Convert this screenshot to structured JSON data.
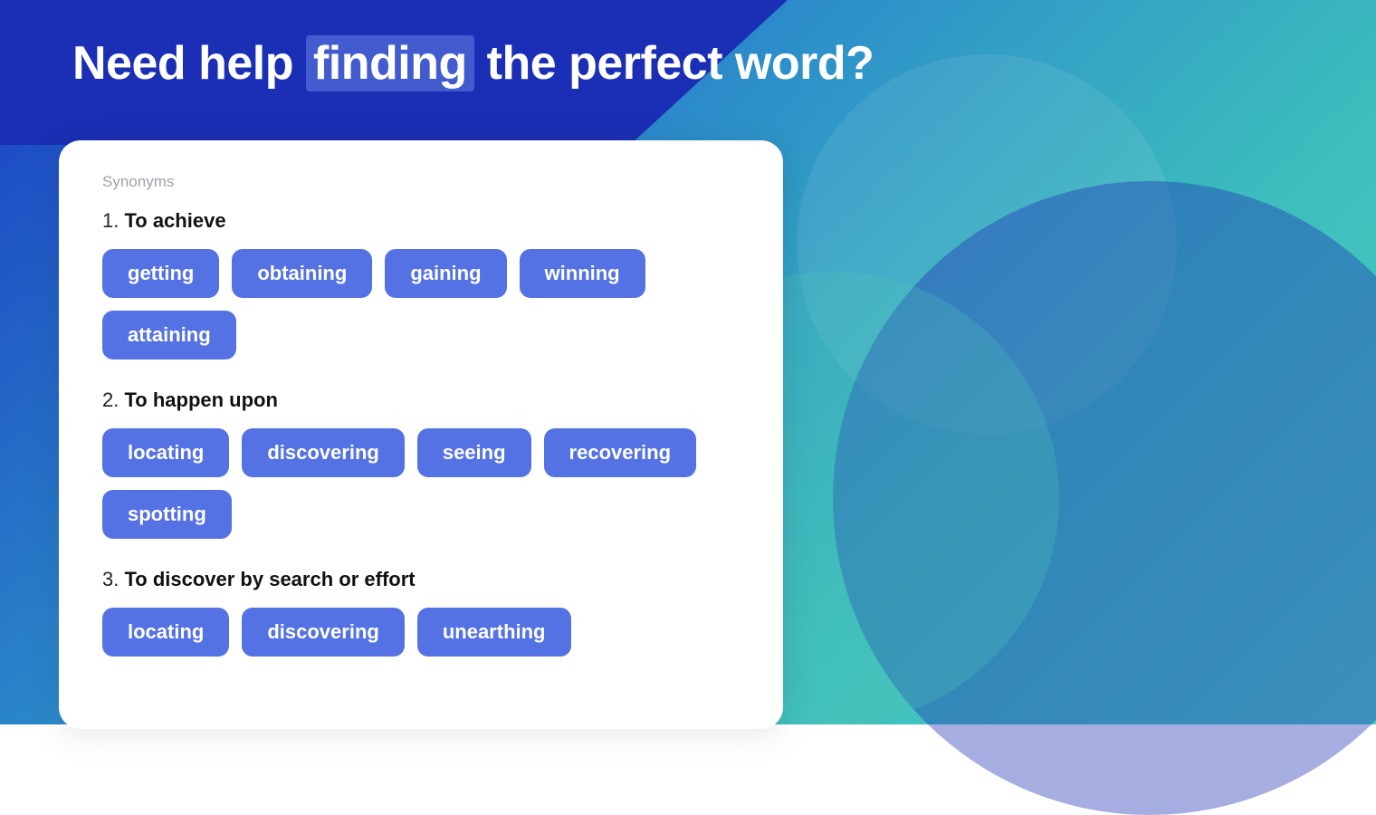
{
  "header": {
    "title_prefix": "Need help ",
    "title_highlight": "finding",
    "title_suffix": " the perfect word?"
  },
  "card": {
    "section_label": "Synonyms",
    "groups": [
      {
        "number": "1.",
        "title": "To achieve",
        "tags": [
          "getting",
          "obtaining",
          "gaining",
          "winning",
          "attaining"
        ]
      },
      {
        "number": "2.",
        "title": "To happen upon",
        "tags": [
          "locating",
          "discovering",
          "seeing",
          "recovering",
          "spotting"
        ]
      },
      {
        "number": "3.",
        "title": "To discover by search or effort",
        "tags": [
          "locating",
          "discovering",
          "unearthing"
        ]
      }
    ]
  }
}
